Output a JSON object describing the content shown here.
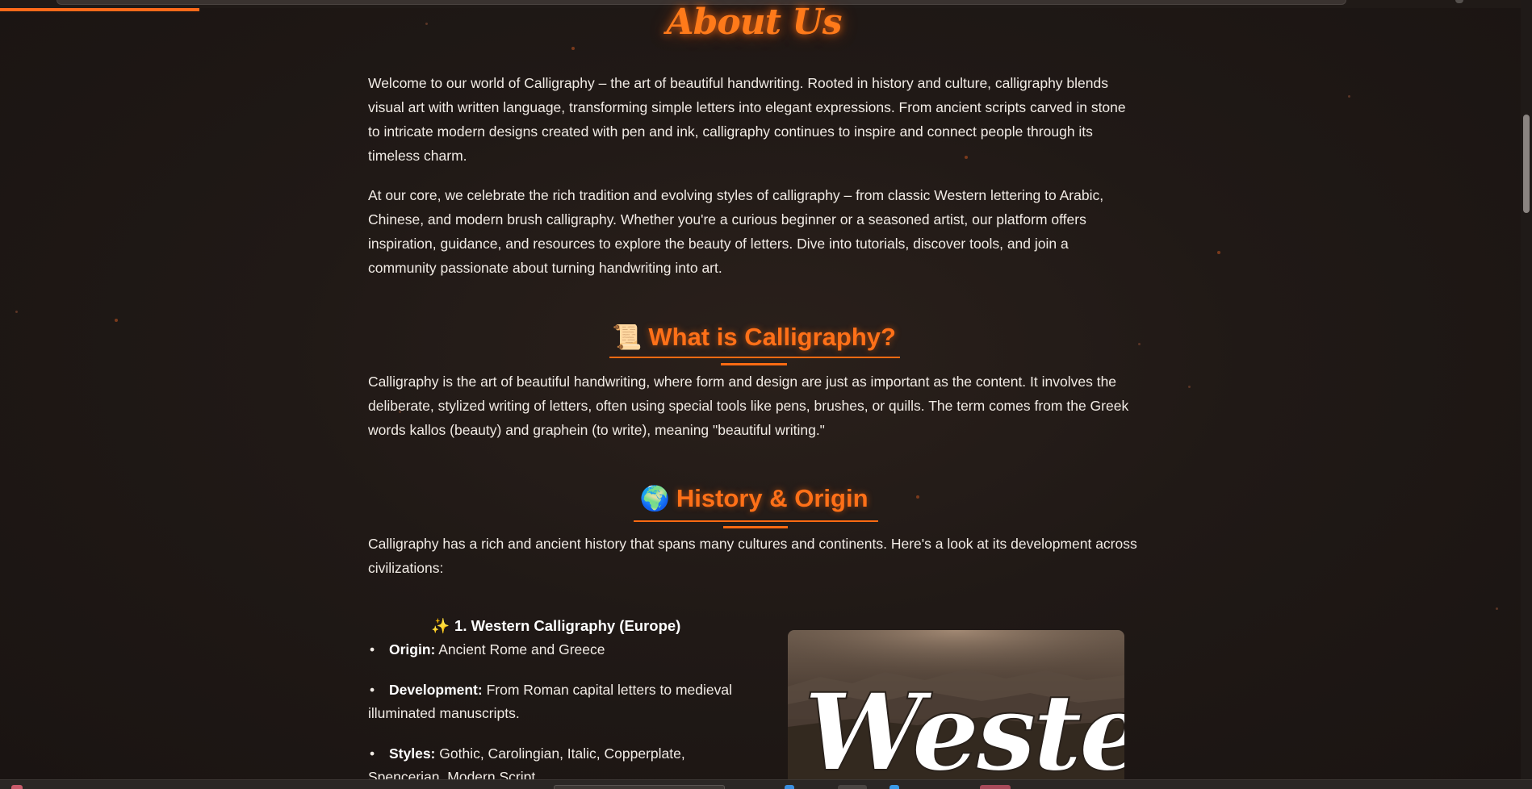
{
  "page": {
    "title": "About Us",
    "scroll_progress_percent": 13
  },
  "intro": {
    "p1": "Welcome to our world of Calligraphy – the art of beautiful handwriting. Rooted in history and culture, calligraphy blends visual art with written language, transforming simple letters into elegant expressions. From ancient scripts carved in stone to intricate modern designs created with pen and ink, calligraphy continues to inspire and connect people through its timeless charm.",
    "p2": "At our core, we celebrate the rich tradition and evolving styles of calligraphy – from classic Western lettering to Arabic, Chinese, and modern brush calligraphy. Whether you're a curious beginner or a seasoned artist, our platform offers inspiration, guidance, and resources to explore the beauty of letters. Dive into tutorials, discover tools, and join a community passionate about turning handwriting into art."
  },
  "what_is": {
    "emoji": "📜",
    "heading": "What is Calligraphy?",
    "text": "Calligraphy is the art of beautiful handwriting, where form and design are just as important as the content. It involves the deliberate, stylized writing of letters, often using special tools like pens, brushes, or quills. The term comes from the Greek words kallos (beauty) and graphein (to write), meaning \"beautiful writing.\""
  },
  "history": {
    "emoji": "🌍",
    "heading": "History & Origin",
    "text": "Calligraphy has a rich and ancient history that spans many cultures and continents. Here's a look at its development across civilizations:"
  },
  "western": {
    "emoji": "✨",
    "heading": "1. Western Calligraphy (Europe)",
    "bullet_char": "•",
    "items": [
      {
        "label": "Origin:",
        "text": " Ancient Rome and Greece"
      },
      {
        "label": "Development:",
        "text": " From Roman capital letters to medieval illuminated manuscripts."
      },
      {
        "label": "Styles:",
        "text": " Gothic, Carolingian, Italic, Copperplate, Spencerian, Modern Script."
      }
    ],
    "image_word": "Western"
  },
  "colors": {
    "accent": "#ff6a1a",
    "background": "#1c1614",
    "text": "#f1ebe5"
  }
}
